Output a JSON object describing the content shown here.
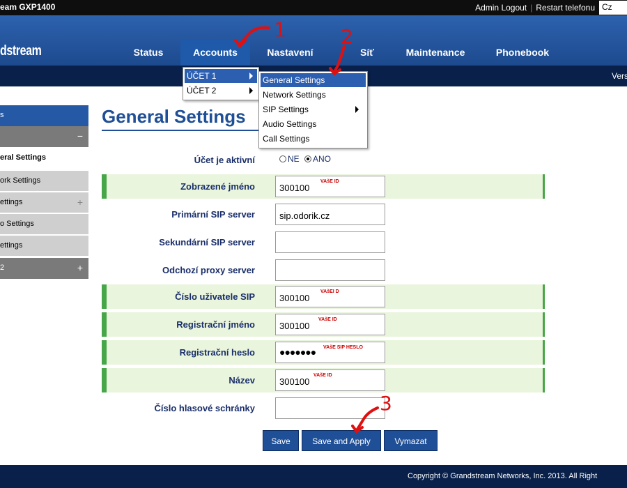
{
  "topbar": {
    "model_title": "eam GXP1400",
    "admin_logout": "Admin Logout",
    "restart_phone": "Restart telefonu",
    "language": "Cz"
  },
  "header": {
    "logo": "dstream",
    "nav": [
      "Status",
      "Accounts",
      "Nastavení",
      "Síť",
      "Maintenance",
      "Phonebook"
    ]
  },
  "subbar": {
    "version_label": "Vers"
  },
  "sidebar": {
    "items": [
      {
        "label": "s",
        "sign": ""
      },
      {
        "label": "",
        "sign": "−"
      },
      {
        "label": "eral Settings",
        "sign": ""
      },
      {
        "label": "ork Settings",
        "sign": ""
      },
      {
        "label": "ettings",
        "sign": "+"
      },
      {
        "label": "o Settings",
        "sign": ""
      },
      {
        "label": "ettings",
        "sign": ""
      },
      {
        "label": "2",
        "sign": "+"
      }
    ]
  },
  "accounts_menu": {
    "items": [
      "ÚČET 1",
      "ÚČET 2"
    ],
    "selected_index": 0
  },
  "account_submenu": {
    "items": [
      "General Settings",
      "Network Settings",
      "SIP Settings",
      "Audio Settings",
      "Call Settings"
    ],
    "selected_index": 0
  },
  "page": {
    "title": "General Settings"
  },
  "form": {
    "active_label": "Účet je aktivní",
    "radio_no": "NE",
    "radio_yes": "ANO",
    "radio_selected": "ANO",
    "rows": [
      {
        "label": "Zobrazené jméno",
        "value": "300100",
        "note": "VAšE ID"
      },
      {
        "label": "Primární SIP server",
        "value": "sip.odorik.cz",
        "note": ""
      },
      {
        "label": "Sekundární SIP server",
        "value": "",
        "note": ""
      },
      {
        "label": "Odchozí proxy server",
        "value": "",
        "note": ""
      },
      {
        "label": "Číslo uživatele SIP",
        "value": "300100",
        "note": "VAšEI D"
      },
      {
        "label": "Registrační jméno",
        "value": "300100",
        "note": "VAšE ID"
      },
      {
        "label": "Registrační heslo",
        "value": "●●●●●●●",
        "note": "VAšE SIP HESLO"
      },
      {
        "label": "Název",
        "value": "300100",
        "note": "VAšE ID"
      },
      {
        "label": "Číslo hlasové schránky",
        "value": "",
        "note": ""
      }
    ]
  },
  "buttons": {
    "save": "Save",
    "save_apply": "Save and Apply",
    "clear": "Vymazat"
  },
  "annotations": [
    "1",
    "2",
    "3"
  ],
  "footer": {
    "copyright": "Copyright © Grandstream Networks, Inc. 2013. All Right"
  },
  "colors": {
    "header_blue": "#2559a5",
    "dark_navy": "#08204a",
    "title_blue": "#1f4f96",
    "highlight_row": "#e9f5dc",
    "highlight_border": "#46a648",
    "annotation_red": "#e01010"
  }
}
